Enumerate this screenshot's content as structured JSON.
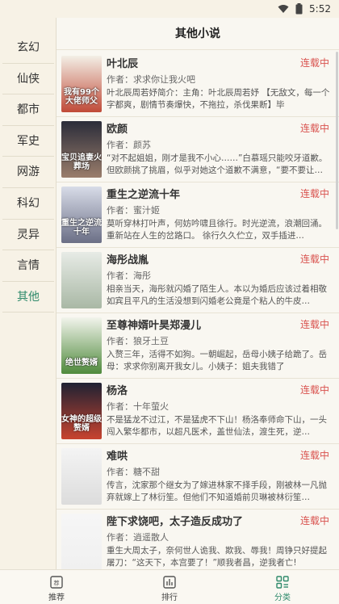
{
  "status": {
    "time": "5:52"
  },
  "sidebar": {
    "items": [
      {
        "label": "玄幻"
      },
      {
        "label": "仙侠"
      },
      {
        "label": "都市"
      },
      {
        "label": "军史"
      },
      {
        "label": "网游"
      },
      {
        "label": "科幻"
      },
      {
        "label": "灵异"
      },
      {
        "label": "言情"
      },
      {
        "label": "其他"
      }
    ],
    "active_index": 8
  },
  "main": {
    "title": "其他小说"
  },
  "books": [
    {
      "title": "叶北辰",
      "status": "连载中",
      "author": "作者：求求你让我火吧",
      "desc": "叶北辰周若妤简介：主角：叶北辰周若妤 【无敌文，每一个字都爽，剧情节奏爆快，不拖拉，杀伐果断】毕",
      "cover_text": "我有99个大佬师父",
      "cover_colors": [
        "#f3efe6",
        "#c04a38"
      ]
    },
    {
      "title": "欧颜",
      "status": "连载中",
      "author": "作者：颜苏",
      "desc": "“对不起姐姐，刚才是我不小心……”白慕瑶只能咬牙道歉。但欧颜挑了挑眉，似乎对她这个道歉不满意，“要不要让…",
      "cover_text": "宝贝追妻火葬场",
      "cover_colors": [
        "#2b2d3a",
        "#9a7d6b"
      ]
    },
    {
      "title": "重生之逆流十年",
      "status": "连载中",
      "author": "作者：蜜汁姬",
      "desc": "莫听穿林打叶声，何妨吟啸且徐行。时光逆流，浪潮回涌。重新站在人生的岔路口。 徐行久久伫立，双手插进…",
      "cover_text": "重生之逆流十年",
      "cover_colors": [
        "#d8dce8",
        "#6b6f86"
      ]
    },
    {
      "title": "海彤战胤",
      "status": "连载中",
      "author": "作者：海彤",
      "desc": "相亲当天，海彤就闪婚了陌生人。本以为婚后应该过着相敬如宾且平凡的生活没想到闪婚老公竟是个粘人的牛皮…",
      "cover_text": "",
      "cover_colors": [
        "#e7ebe6",
        "#a9b8a5"
      ]
    },
    {
      "title": "至尊神婿叶昊郑漫儿",
      "status": "连载中",
      "author": "作者：狼牙土豆",
      "desc": "入赘三年，活得不如狗。一朝崛起，岳母小姨子给跪了。岳母：求求你别离开我女儿。小姨子：姐夫我错了",
      "cover_text": "绝世赘婿",
      "cover_colors": [
        "#f2f4ec",
        "#4f8a3c"
      ]
    },
    {
      "title": "杨洛",
      "status": "连载中",
      "author": "作者：十年萤火",
      "desc": "不是猛龙不过江，不是猛虎不下山！杨洛奉师命下山，一头闯入繁华都市，以超凡医术，盖世仙法，渡生死，逆…",
      "cover_text": "女神的超级赘婿",
      "cover_colors": [
        "#1f2233",
        "#c8432f"
      ]
    },
    {
      "title": "难哄",
      "status": "连载中",
      "author": "作者：糖不甜",
      "desc": "传言，沈家那个继女为了嫁进林家不择手段，刚被林一凡抛弃就嫁上了林衍笙。但他们不知道婚前贝琳被林衍笙…",
      "cover_text": "",
      "cover_colors": [
        "#f4f4f4",
        "#dcdcdc"
      ]
    },
    {
      "title": "陛下求饶吧，太子造反成功了",
      "status": "连载中",
      "author": "作者：逍遥散人",
      "desc": "重生大周太子，奈何世人诡我、欺我、辱我！周铮只好提起屠刀：“这天下，本宫要了！”顺我者昌，逆我者亡!",
      "cover_text": "",
      "cover_colors": [
        "#f6f6f6",
        "#f0f0f0"
      ]
    }
  ],
  "bottom_nav": [
    {
      "label": "推荐",
      "icon": "recommend-icon"
    },
    {
      "label": "排行",
      "icon": "ranking-icon"
    },
    {
      "label": "分类",
      "icon": "category-icon"
    }
  ],
  "colors": {
    "accent": "#2f8a6b",
    "status_red": "#d9534f"
  }
}
